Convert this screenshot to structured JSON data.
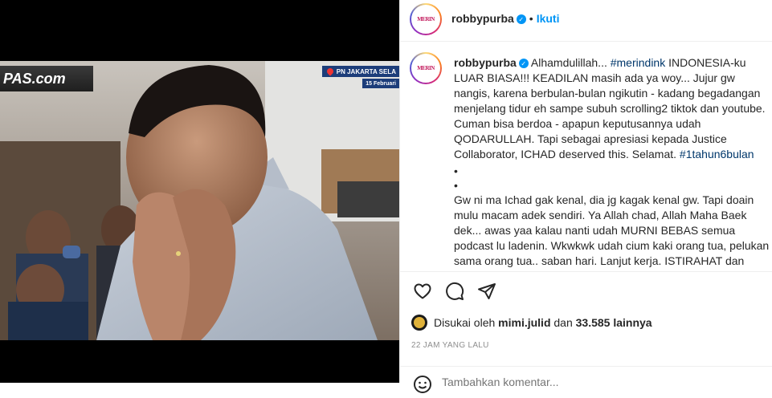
{
  "media": {
    "channel_logo": "PAS.com",
    "location": "PN JAKARTA SELA",
    "date": "15 Februari"
  },
  "post": {
    "username": "robbypurba",
    "follow_label": "Ikuti",
    "separator": "•",
    "caption": {
      "line1_before_tag": "Alhamdulillah... ",
      "tag1": "#merindink",
      "line1_after_tag": " INDONESIA-ku LUAR BIASA!!! KEADILAN masih ada ya woy... Jujur gw nangis, karena berbulan-bulan ngikutin - kadang begadangan menjelang tidur eh sampe subuh scrolling2 tiktok dan youtube. Cuman bisa berdoa - apapun keputusannya udah QODARULLAH. Tapi sebagai apresiasi kepada Justice Collaborator, ICHAD deserved this. Selamat. ",
      "tag2": "#1tahun6bulan",
      "bullet1": "•",
      "bullet2": "•",
      "paragraph2": "Gw ni ma Ichad gak kenal, dia jg kagak kenal gw. Tapi doain mulu macam adek sendiri. Ya Allah chad, Allah Maha Baek dek... awas yaa kalau nanti udah MURNI BEBAS semua podcast lu ladenin. Wkwkwk udah cium kaki orang tua, pelukan sama orang tua.. saban hari. Lanjut kerja. ISTIRAHAT dan TERUS BERDOA."
    },
    "likes": {
      "prefix": "Disukai oleh",
      "first_user": "mimi.julid",
      "conj": "dan",
      "count": "33.585 lainnya"
    },
    "timestamp": "22 JAM YANG LALU",
    "comment_placeholder": "Tambahkan komentar..."
  },
  "icons": {
    "like": "heart-icon",
    "comment": "comment-icon",
    "share": "paper-plane-icon",
    "verified": "verified-badge-icon",
    "emoji": "smiley-icon"
  },
  "colors": {
    "link_blue": "#0095f6",
    "hashtag": "#00376b",
    "text": "#262626",
    "muted": "#8e8e8e"
  }
}
